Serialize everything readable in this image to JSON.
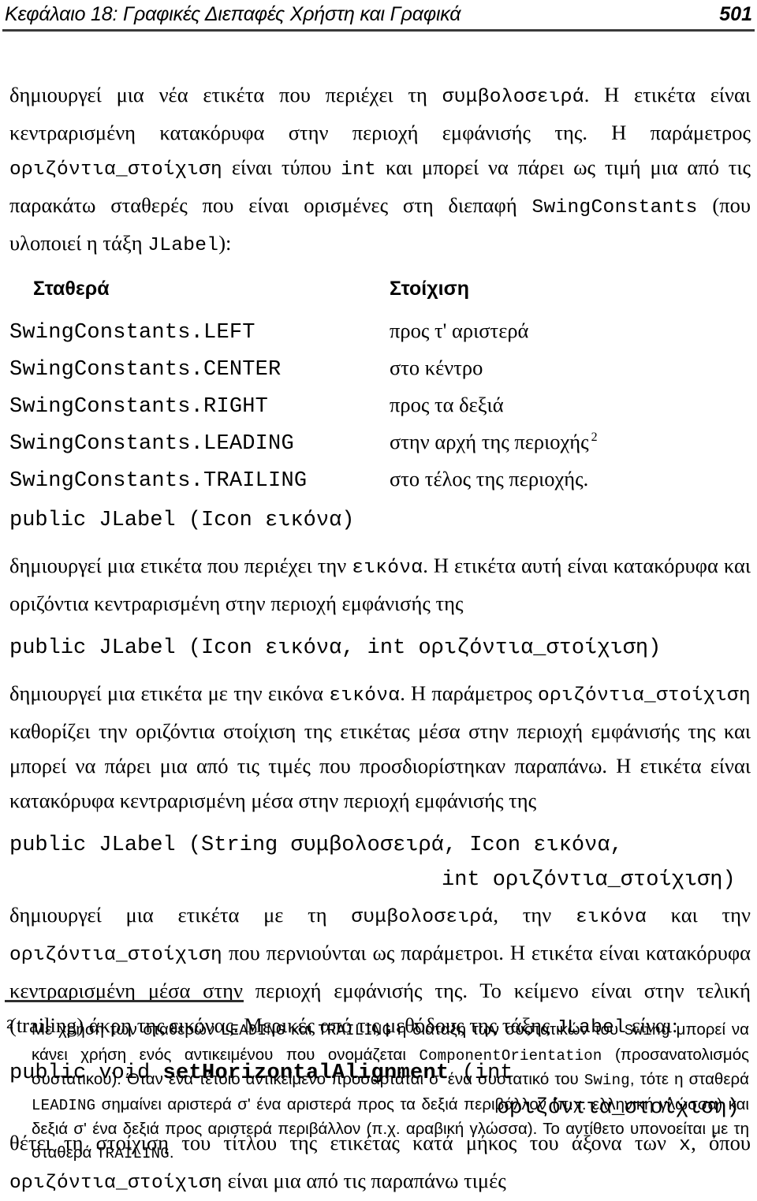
{
  "header": {
    "title": "Κεφάλαιο 18: Γραφικές Διεπαφές Χρήστη και Γραφικά",
    "page_number": "501"
  },
  "body": {
    "para1": {
      "seg1": "δημιουργεί μια νέα ετικέτα που περιέχει τη ",
      "code1": "συμβολοσειρά",
      "seg2": ". Η ετικέτα είναι κεντραρισμένη κατακόρυφα στην περιοχή εμφάνισής της. Η παράμετρος ",
      "code2": "οριζόντια_στοίχιση",
      "seg3": " είναι τύπου ",
      "code3": "int",
      "seg4": " και μπορεί να πάρει ως τιμή μια από τις παρακάτω σταθερές που είναι ορισμένες στη διεπαφή ",
      "code4": "SwingConstants",
      "seg5": " (που υλοποιεί η τάξη ",
      "code5": "JLabel",
      "seg6": "):"
    },
    "table": {
      "headers": [
        "Σταθερά",
        "Στοίχιση"
      ],
      "rows": [
        {
          "constant": "SwingConstants.LEFT",
          "alignment": "προς τ' αριστερά",
          "footnote": ""
        },
        {
          "constant": "SwingConstants.CENTER",
          "alignment": "στο κέντρο",
          "footnote": ""
        },
        {
          "constant": "SwingConstants.RIGHT",
          "alignment": "προς τα δεξιά",
          "footnote": ""
        },
        {
          "constant": "SwingConstants.LEADING",
          "alignment": "στην αρχή της περιοχής",
          "footnote": "2"
        },
        {
          "constant": "SwingConstants.TRAILING",
          "alignment": "στο τέλος της περιοχής.",
          "footnote": ""
        }
      ]
    },
    "signature1": "public JLabel (Icon εικόνα)",
    "para2": {
      "seg1": "δημιουργεί μια ετικέτα που περιέχει την ",
      "code1": "εικόνα",
      "seg2": ". Η ετικέτα αυτή είναι κατακόρυφα και οριζόντια κεντραρισμένη στην περιοχή εμφάνισής της"
    },
    "signature2": "public JLabel (Icon εικόνα, int οριζόντια_στοίχιση)",
    "para3": {
      "seg1": "δημιουργεί μια ετικέτα με την εικόνα ",
      "code1": "εικόνα",
      "seg2": ". Η παράμετρος ",
      "code2": "οριζόντια_στοίχιση",
      "seg3": " καθορίζει την οριζόντια στοίχιση της ετικέτας μέσα στην περιοχή εμφάνισής της και μπορεί να πάρει μια από τις τιμές που προσδιορίστηκαν παραπάνω. Η ετικέτα είναι κατακόρυφα κεντραρισμένη μέσα στην περιοχή εμφάνισής της"
    },
    "signature3_line1": "public JLabel (String συμβολοσειρά, Icon εικόνα,",
    "signature3_line2": "int οριζόντια_στοίχιση)",
    "para4": {
      "seg1": "δημιουργεί μια ετικέτα με τη ",
      "code1": "συμβολοσειρά",
      "seg2": ", την ",
      "code2": "εικόνα",
      "seg3": " και την ",
      "code3": "οριζόντια_στοίχιση",
      "seg4": " που περνιούνται ως παράμετροι. Η ετικέτα είναι κατακόρυφα κεντραρισμένη μέσα στην περιοχή εμφάνισής της. Το κείμενο είναι στην τελική (trailing) άκρη της εικόνας. Μερικές από τις μεθόδους της τάξης ",
      "code4": "JLabel",
      "seg5": " είναι:"
    },
    "method_line1_pre": "public void ",
    "method_line1_bold": "setHorizontalAlignment",
    "method_line1_post": " (int",
    "method_line2": "οριζόντια_στοίχιση)",
    "para5": {
      "seg1": "θέτει τη στοίχιση του τίτλου της ετικέτας κατά μήκος του άξονα των ",
      "code1": "x",
      "seg2": ", όπου ",
      "code2": "οριζόντια_στοίχιση",
      "seg3": " είναι μια από τις παραπάνω τιμές"
    }
  },
  "footnote": {
    "marker": "2",
    "seg1": "Με χρήση των σταθερών ",
    "code1": "LEADING",
    "seg2": " και ",
    "code2": "TRAILING",
    "seg3": " η διάταξη των συστατικών του ",
    "code3": "Swing",
    "seg4": " μπορεί να κάνει χρήση ενός αντικειμένου που ονομάζεται ",
    "code4": "ComponentOrientation",
    "seg5": " (προσανατολισμός συστατικού). Όταν ένα τέτοιο αντικείμενο προσαρτάται σ' ένα συστατικό του ",
    "code5": "Swing",
    "seg6": ", τότε η σταθερά ",
    "code6": "LEADING",
    "seg7": " σημαίνει αριστερά σ' ένα αριστερά προς τα δεξιά περιβάλλον (π.χ. ελληνική γλώσσα) και δεξιά σ' ένα δεξιά προς αριστερά περιβάλλον (π.χ. αραβική γλώσσα). Το αντίθετο υπονοείται με τη σταθερά ",
    "code7": "TRAILING",
    "seg8": "."
  }
}
